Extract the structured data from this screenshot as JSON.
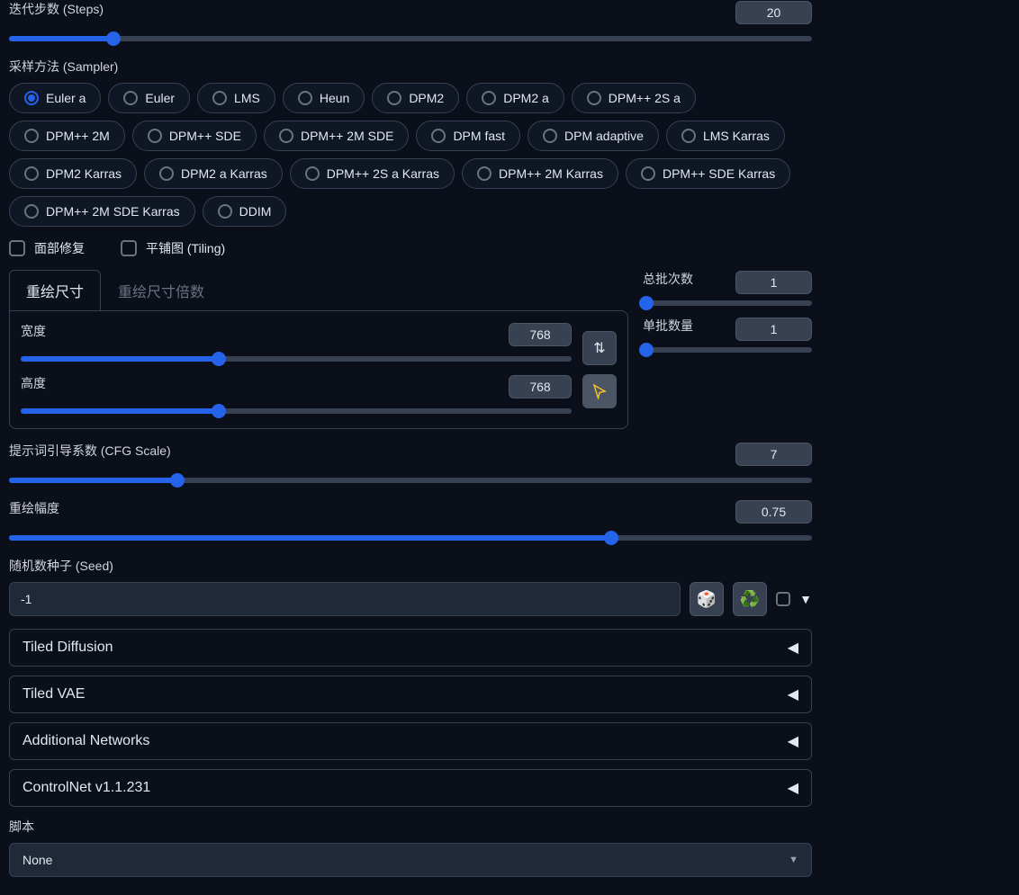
{
  "steps": {
    "label": "迭代步数 (Steps)",
    "value": "20",
    "percent": 13
  },
  "sampler": {
    "label": "采样方法 (Sampler)",
    "selected": "Euler a",
    "options": [
      "Euler a",
      "Euler",
      "LMS",
      "Heun",
      "DPM2",
      "DPM2 a",
      "DPM++ 2S a",
      "DPM++ 2M",
      "DPM++ SDE",
      "DPM++ 2M SDE",
      "DPM fast",
      "DPM adaptive",
      "LMS Karras",
      "DPM2 Karras",
      "DPM2 a Karras",
      "DPM++ 2S a Karras",
      "DPM++ 2M Karras",
      "DPM++ SDE Karras",
      "DPM++ 2M SDE Karras",
      "DDIM"
    ]
  },
  "checkboxes": {
    "face_restore": "面部修复",
    "tiling": "平铺图 (Tiling)"
  },
  "size_tabs": {
    "resize": "重绘尺寸",
    "resize_by": "重绘尺寸倍数"
  },
  "size": {
    "width_label": "宽度",
    "width_value": "768",
    "width_percent": 36,
    "height_label": "高度",
    "height_value": "768",
    "height_percent": 36
  },
  "batch": {
    "count_label": "总批次数",
    "count_value": "1",
    "count_percent": 0,
    "size_label": "单批数量",
    "size_value": "1",
    "size_percent": 0
  },
  "cfg": {
    "label": "提示词引导系数 (CFG Scale)",
    "value": "7",
    "percent": 21
  },
  "denoise": {
    "label": "重绘幅度",
    "value": "0.75",
    "percent": 75
  },
  "seed": {
    "label": "随机数种子 (Seed)",
    "value": "-1"
  },
  "accordions": [
    "Tiled Diffusion",
    "Tiled VAE",
    "Additional Networks",
    "ControlNet v1.1.231"
  ],
  "script": {
    "label": "脚本",
    "value": "None"
  },
  "triangle": "▼",
  "arrow_left": "◀"
}
